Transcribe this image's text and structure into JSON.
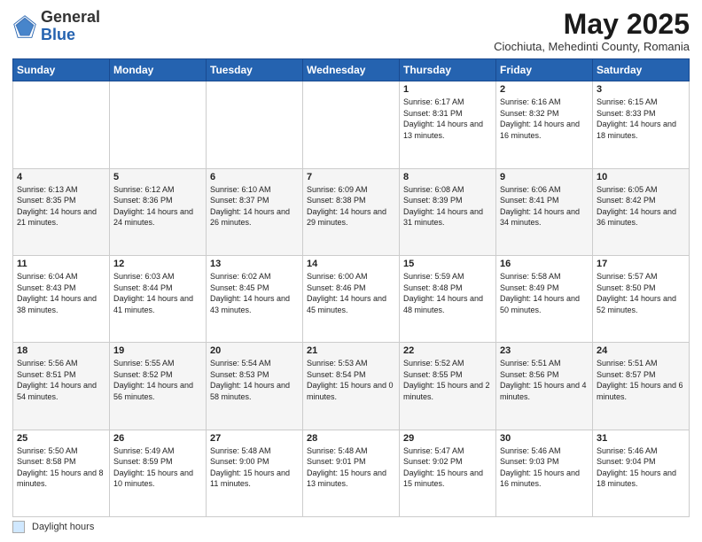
{
  "header": {
    "logo_general": "General",
    "logo_blue": "Blue",
    "month_title": "May 2025",
    "subtitle": "Ciochiuta, Mehedinti County, Romania"
  },
  "days_of_week": [
    "Sunday",
    "Monday",
    "Tuesday",
    "Wednesday",
    "Thursday",
    "Friday",
    "Saturday"
  ],
  "footer": {
    "legend_label": "Daylight hours"
  },
  "weeks": [
    {
      "days": [
        {
          "num": "",
          "info": ""
        },
        {
          "num": "",
          "info": ""
        },
        {
          "num": "",
          "info": ""
        },
        {
          "num": "",
          "info": ""
        },
        {
          "num": "1",
          "info": "Sunrise: 6:17 AM\nSunset: 8:31 PM\nDaylight: 14 hours\nand 13 minutes."
        },
        {
          "num": "2",
          "info": "Sunrise: 6:16 AM\nSunset: 8:32 PM\nDaylight: 14 hours\nand 16 minutes."
        },
        {
          "num": "3",
          "info": "Sunrise: 6:15 AM\nSunset: 8:33 PM\nDaylight: 14 hours\nand 18 minutes."
        }
      ]
    },
    {
      "days": [
        {
          "num": "4",
          "info": "Sunrise: 6:13 AM\nSunset: 8:35 PM\nDaylight: 14 hours\nand 21 minutes."
        },
        {
          "num": "5",
          "info": "Sunrise: 6:12 AM\nSunset: 8:36 PM\nDaylight: 14 hours\nand 24 minutes."
        },
        {
          "num": "6",
          "info": "Sunrise: 6:10 AM\nSunset: 8:37 PM\nDaylight: 14 hours\nand 26 minutes."
        },
        {
          "num": "7",
          "info": "Sunrise: 6:09 AM\nSunset: 8:38 PM\nDaylight: 14 hours\nand 29 minutes."
        },
        {
          "num": "8",
          "info": "Sunrise: 6:08 AM\nSunset: 8:39 PM\nDaylight: 14 hours\nand 31 minutes."
        },
        {
          "num": "9",
          "info": "Sunrise: 6:06 AM\nSunset: 8:41 PM\nDaylight: 14 hours\nand 34 minutes."
        },
        {
          "num": "10",
          "info": "Sunrise: 6:05 AM\nSunset: 8:42 PM\nDaylight: 14 hours\nand 36 minutes."
        }
      ]
    },
    {
      "days": [
        {
          "num": "11",
          "info": "Sunrise: 6:04 AM\nSunset: 8:43 PM\nDaylight: 14 hours\nand 38 minutes."
        },
        {
          "num": "12",
          "info": "Sunrise: 6:03 AM\nSunset: 8:44 PM\nDaylight: 14 hours\nand 41 minutes."
        },
        {
          "num": "13",
          "info": "Sunrise: 6:02 AM\nSunset: 8:45 PM\nDaylight: 14 hours\nand 43 minutes."
        },
        {
          "num": "14",
          "info": "Sunrise: 6:00 AM\nSunset: 8:46 PM\nDaylight: 14 hours\nand 45 minutes."
        },
        {
          "num": "15",
          "info": "Sunrise: 5:59 AM\nSunset: 8:48 PM\nDaylight: 14 hours\nand 48 minutes."
        },
        {
          "num": "16",
          "info": "Sunrise: 5:58 AM\nSunset: 8:49 PM\nDaylight: 14 hours\nand 50 minutes."
        },
        {
          "num": "17",
          "info": "Sunrise: 5:57 AM\nSunset: 8:50 PM\nDaylight: 14 hours\nand 52 minutes."
        }
      ]
    },
    {
      "days": [
        {
          "num": "18",
          "info": "Sunrise: 5:56 AM\nSunset: 8:51 PM\nDaylight: 14 hours\nand 54 minutes."
        },
        {
          "num": "19",
          "info": "Sunrise: 5:55 AM\nSunset: 8:52 PM\nDaylight: 14 hours\nand 56 minutes."
        },
        {
          "num": "20",
          "info": "Sunrise: 5:54 AM\nSunset: 8:53 PM\nDaylight: 14 hours\nand 58 minutes."
        },
        {
          "num": "21",
          "info": "Sunrise: 5:53 AM\nSunset: 8:54 PM\nDaylight: 15 hours\nand 0 minutes."
        },
        {
          "num": "22",
          "info": "Sunrise: 5:52 AM\nSunset: 8:55 PM\nDaylight: 15 hours\nand 2 minutes."
        },
        {
          "num": "23",
          "info": "Sunrise: 5:51 AM\nSunset: 8:56 PM\nDaylight: 15 hours\nand 4 minutes."
        },
        {
          "num": "24",
          "info": "Sunrise: 5:51 AM\nSunset: 8:57 PM\nDaylight: 15 hours\nand 6 minutes."
        }
      ]
    },
    {
      "days": [
        {
          "num": "25",
          "info": "Sunrise: 5:50 AM\nSunset: 8:58 PM\nDaylight: 15 hours\nand 8 minutes."
        },
        {
          "num": "26",
          "info": "Sunrise: 5:49 AM\nSunset: 8:59 PM\nDaylight: 15 hours\nand 10 minutes."
        },
        {
          "num": "27",
          "info": "Sunrise: 5:48 AM\nSunset: 9:00 PM\nDaylight: 15 hours\nand 11 minutes."
        },
        {
          "num": "28",
          "info": "Sunrise: 5:48 AM\nSunset: 9:01 PM\nDaylight: 15 hours\nand 13 minutes."
        },
        {
          "num": "29",
          "info": "Sunrise: 5:47 AM\nSunset: 9:02 PM\nDaylight: 15 hours\nand 15 minutes."
        },
        {
          "num": "30",
          "info": "Sunrise: 5:46 AM\nSunset: 9:03 PM\nDaylight: 15 hours\nand 16 minutes."
        },
        {
          "num": "31",
          "info": "Sunrise: 5:46 AM\nSunset: 9:04 PM\nDaylight: 15 hours\nand 18 minutes."
        }
      ]
    }
  ]
}
